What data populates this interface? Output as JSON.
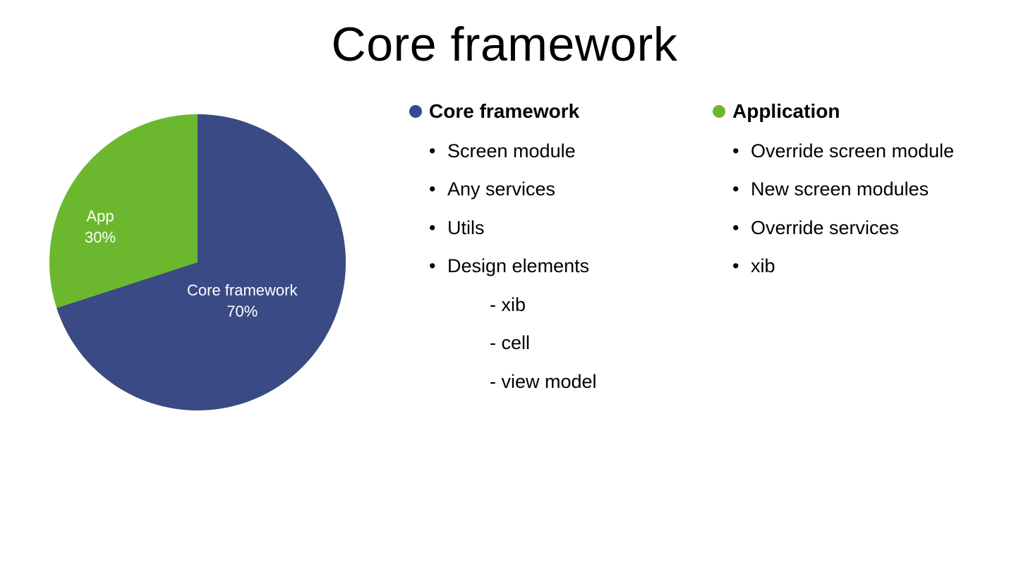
{
  "title": "Core framework",
  "chart_data": {
    "type": "pie",
    "title": "Core framework",
    "series": [
      {
        "name": "Core framework",
        "value": 70,
        "label1": "Core framework",
        "label2": "70%",
        "color": "#3a4a85"
      },
      {
        "name": "App",
        "value": 30,
        "label1": "App",
        "label2": "30%",
        "color": "#6bb82e"
      }
    ]
  },
  "colors": {
    "core": "#3a4a85",
    "app": "#6bb82e"
  },
  "columns": {
    "core": {
      "header": "Core framework",
      "items": [
        "Screen module",
        "Any services",
        "Utils",
        "Design elements"
      ],
      "subitems": [
        "xib",
        "cell",
        "view model"
      ]
    },
    "app": {
      "header": "Application",
      "items": [
        "Override screen module",
        "New screen modules",
        "Override services",
        "xib"
      ]
    }
  }
}
